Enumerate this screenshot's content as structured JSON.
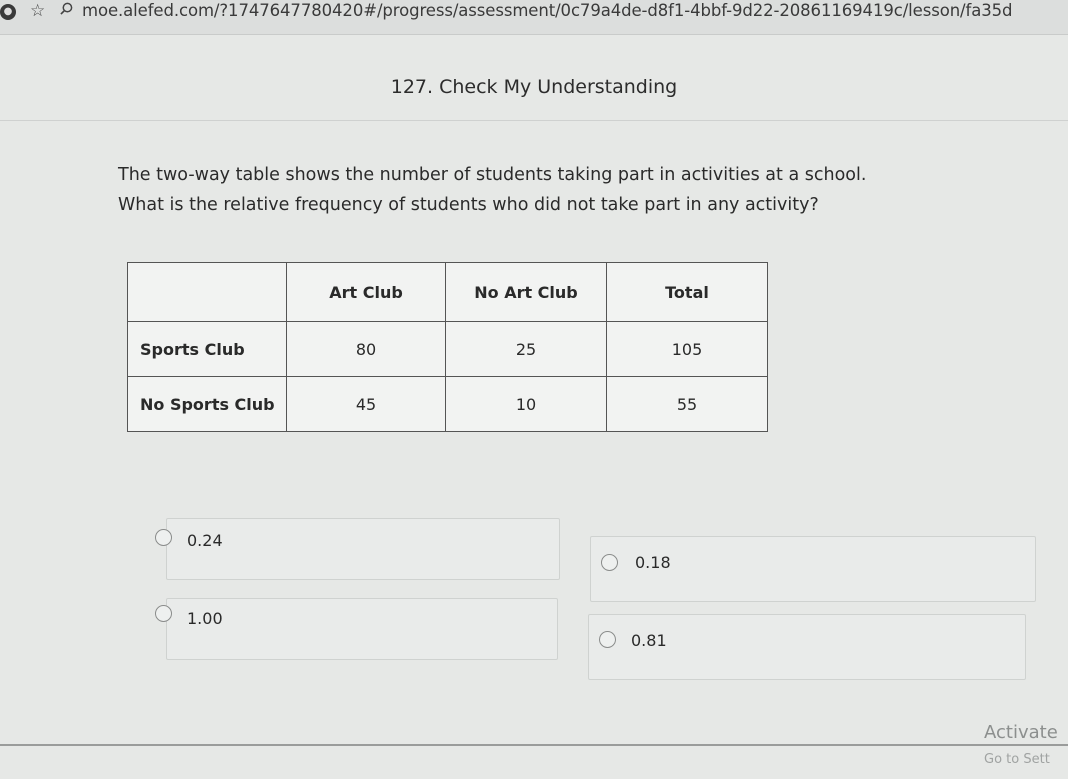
{
  "browser": {
    "url": "moe.alefed.com/?1747647780420#/progress/assessment/0c79a4de-d8f1-4bbf-9d22-20861169419c/lesson/fa35d"
  },
  "page": {
    "title": "127. Check My Understanding"
  },
  "question": {
    "line1": "The two-way table shows the number of students taking part in activities at a school.",
    "line2": "What is the relative frequency of students who did not take part in any activity?"
  },
  "table": {
    "headers": [
      "Art Club",
      "No Art Club",
      "Total"
    ],
    "rows": [
      {
        "label": "Sports Club",
        "values": [
          "80",
          "25",
          "105"
        ]
      },
      {
        "label": "No Sports Club",
        "values": [
          "45",
          "10",
          "55"
        ]
      }
    ]
  },
  "options": [
    {
      "label": "0.24"
    },
    {
      "label": "0.18"
    },
    {
      "label": "1.00"
    },
    {
      "label": "0.81"
    }
  ],
  "watermark": {
    "line1": "Activate",
    "line2": "Go to Sett"
  }
}
